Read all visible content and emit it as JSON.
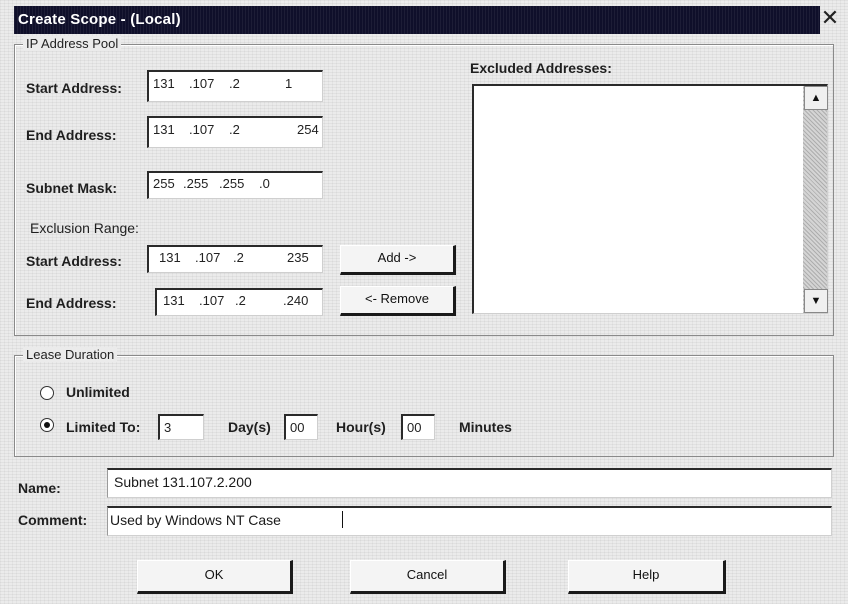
{
  "dialog": {
    "title": "Create Scope - (Local)",
    "close_glyph": "✕"
  },
  "ip_pool": {
    "legend": "IP Address Pool",
    "start_label": "Start Address:",
    "start_value": [
      "131",
      ".107",
      ".2",
      "1"
    ],
    "end_label": "End Address:",
    "end_value": [
      "131",
      ".107",
      ".2",
      "254"
    ],
    "subnet_label": "Subnet Mask:",
    "subnet_value": [
      "255",
      ".255",
      ".255",
      ".0"
    ],
    "exclusion_heading": "Exclusion Range:",
    "excl_start_label": "Start Address:",
    "excl_start_value": [
      "131",
      ".107",
      ".2",
      "235"
    ],
    "excl_end_label": "End Address:",
    "excl_end_value": [
      "131",
      ".107",
      ".2",
      ".240"
    ],
    "add_button": "Add ->",
    "remove_button": "<- Remove",
    "excluded_label": "Excluded Addresses:",
    "excluded_items": []
  },
  "lease": {
    "legend": "Lease Duration",
    "unlimited_label": "Unlimited",
    "unlimited_selected": false,
    "limited_label": "Limited To:",
    "limited_selected": true,
    "days_value": "3",
    "days_label": "Day(s)",
    "hours_value": "00",
    "hours_label": "Hour(s)",
    "minutes_value": "00",
    "minutes_label": "Minutes"
  },
  "name": {
    "label": "Name:",
    "value": "Subnet 131.107.2.200"
  },
  "comment": {
    "label": "Comment:",
    "value": "Used by Windows NT Case"
  },
  "buttons": {
    "ok": "OK",
    "cancel": "Cancel",
    "help": "Help"
  },
  "scroll": {
    "up_glyph": "▲",
    "down_glyph": "▼"
  }
}
